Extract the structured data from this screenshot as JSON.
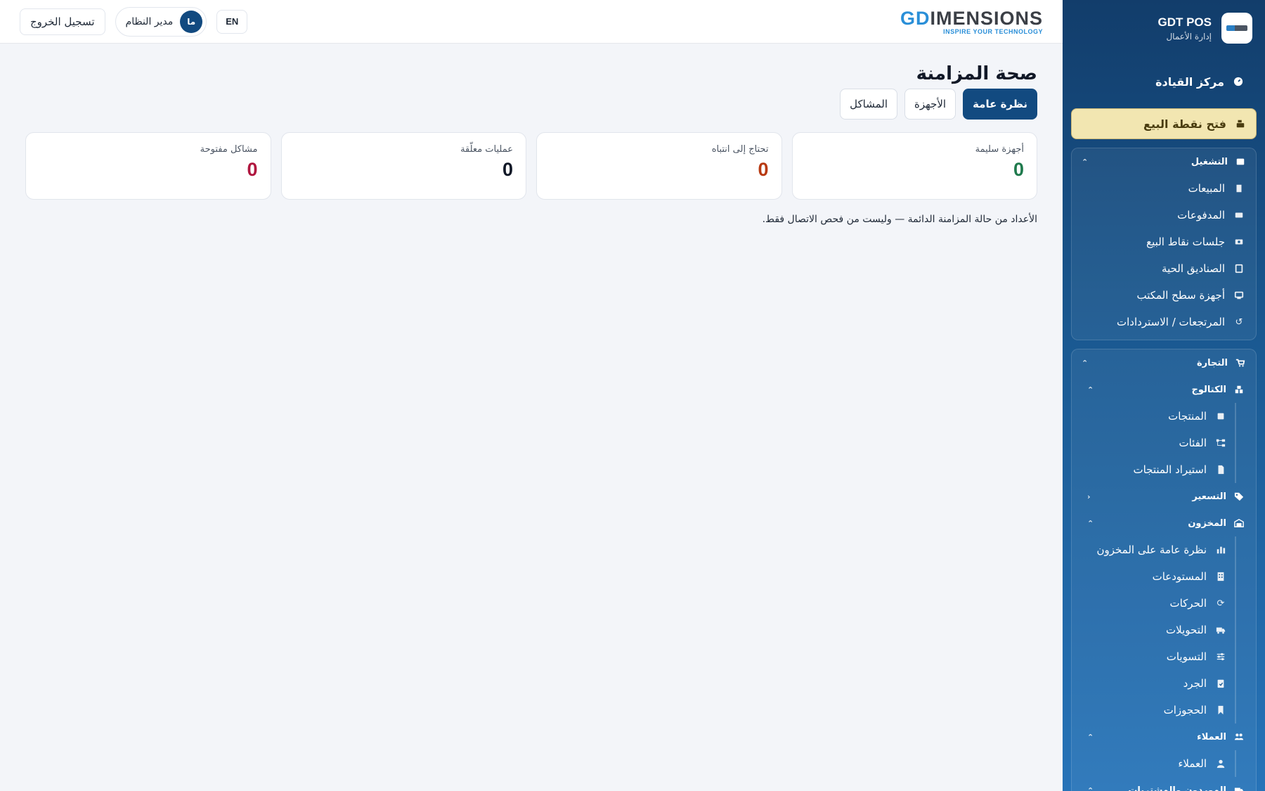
{
  "header": {
    "logo_prefix": "GD",
    "logo_rest": "IMENSIONS",
    "tagline": "INSPIRE YOUR TECHNOLOGY",
    "lang_label": "EN",
    "user_name": "مدير النظام",
    "user_initials": "ما",
    "logout_label": "تسجيل الخروج"
  },
  "sidebar": {
    "brand_title": "GDT POS",
    "brand_subtitle": "إدارة الأعمال",
    "command_center": "مركز القيادة",
    "open_pos": "فتح نقطة البيع",
    "operations": {
      "title": "التشغيل",
      "items": [
        {
          "label": "المبيعات",
          "icon": "receipt-icon"
        },
        {
          "label": "المدفوعات",
          "icon": "credit-card-icon"
        },
        {
          "label": "جلسات نقاط البيع",
          "icon": "cash-register-icon"
        },
        {
          "label": "الصناديق الحية",
          "icon": "tablet-icon"
        },
        {
          "label": "أجهزة سطح المكتب",
          "icon": "desktop-icon"
        },
        {
          "label": "المرتجعات / الاستردادات",
          "icon": "undo-icon"
        }
      ]
    },
    "commerce": {
      "title": "التجارة",
      "catalog": {
        "title": "الكتالوج",
        "items": [
          {
            "label": "المنتجات",
            "icon": "box-icon"
          },
          {
            "label": "الفئات",
            "icon": "sitemap-icon"
          },
          {
            "label": "استيراد المنتجات",
            "icon": "file-import-icon"
          }
        ]
      },
      "pricing": {
        "title": "التسعير"
      },
      "inventory": {
        "title": "المخزون",
        "items": [
          {
            "label": "نظرة عامة على المخزون",
            "icon": "bar-chart-icon"
          },
          {
            "label": "المستودعات",
            "icon": "building-icon"
          },
          {
            "label": "الحركات",
            "icon": "refresh-icon"
          },
          {
            "label": "التحويلات",
            "icon": "truck-icon"
          },
          {
            "label": "التسويات",
            "icon": "sliders-icon"
          },
          {
            "label": "الجرد",
            "icon": "clipboard-icon"
          },
          {
            "label": "الحجوزات",
            "icon": "bookmark-icon"
          }
        ]
      },
      "customers": {
        "title": "العملاء",
        "items": [
          {
            "label": "العملاء",
            "icon": "user-icon"
          }
        ]
      },
      "suppliers": {
        "title": "الموردون والمشتريات"
      }
    }
  },
  "main": {
    "title": "صحة المزامنة",
    "tabs": [
      "نظرة عامة",
      "الأجهزة",
      "المشاكل"
    ],
    "cards": [
      {
        "label": "أجهزة سليمة",
        "value": "0",
        "color": "#1f7a4d"
      },
      {
        "label": "تحتاج إلى انتباه",
        "value": "0",
        "color": "#b83a12"
      },
      {
        "label": "عمليات معلّقة",
        "value": "0",
        "color": "#111827"
      },
      {
        "label": "مشاكل مفتوحة",
        "value": "0",
        "color": "#b0163f"
      }
    ],
    "note": "الأعداد من حالة المزامنة الدائمة — وليست من فحص الاتصال فقط."
  }
}
